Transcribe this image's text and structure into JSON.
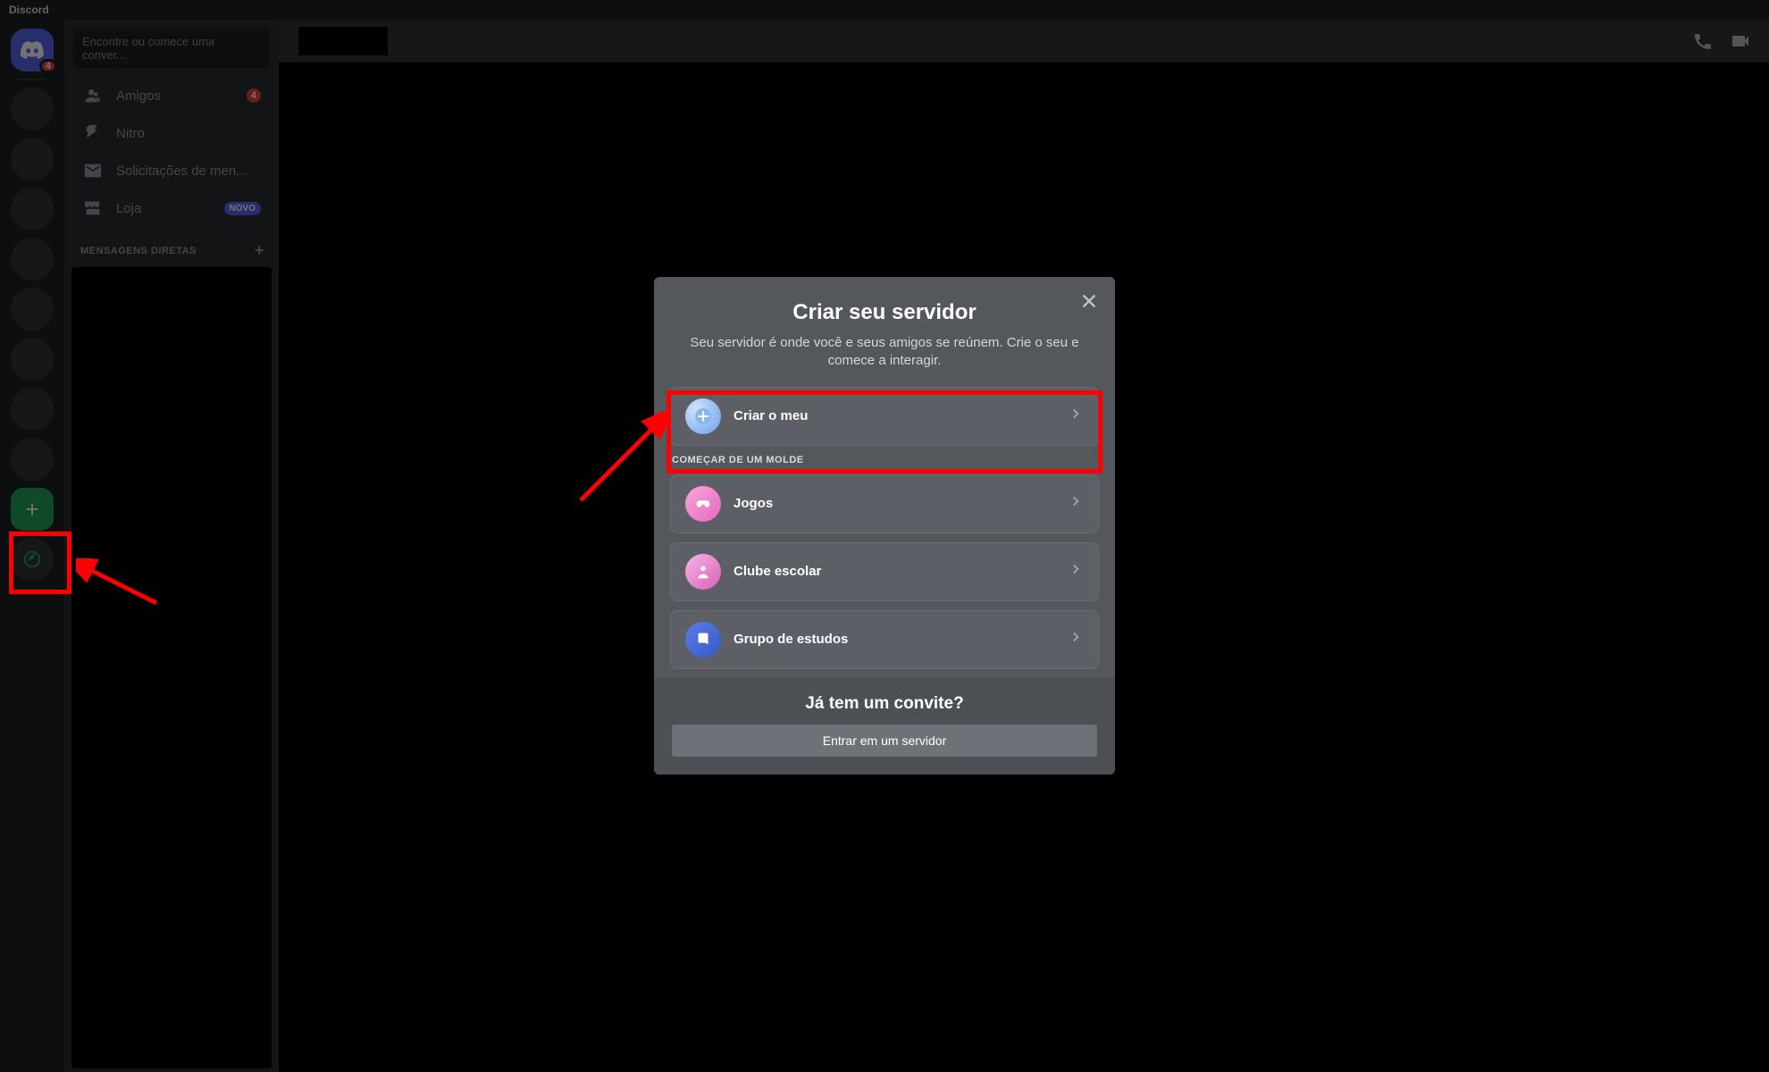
{
  "titlebar": "Discord",
  "home_badge": "4",
  "search": {
    "placeholder": "Encontre ou comece uma conver..."
  },
  "nav": {
    "friends": "Amigos",
    "friends_badge": "4",
    "nitro": "Nitro",
    "requests": "Solicitações de men...",
    "shop": "Loja",
    "shop_badge": "NOVO"
  },
  "dm": {
    "header": "MENSAGENS DIRETAS"
  },
  "modal": {
    "title": "Criar seu servidor",
    "subtitle": "Seu servidor é onde você e seus amigos se reúnem. Crie o seu e comece a interagir.",
    "create_own": "Criar o meu",
    "template_header": "COMEÇAR DE UM MOLDE",
    "opt_games": "Jogos",
    "opt_club": "Clube escolar",
    "opt_study": "Grupo de estudos",
    "footer_title": "Já tem um convite?",
    "footer_btn": "Entrar em um servidor"
  }
}
